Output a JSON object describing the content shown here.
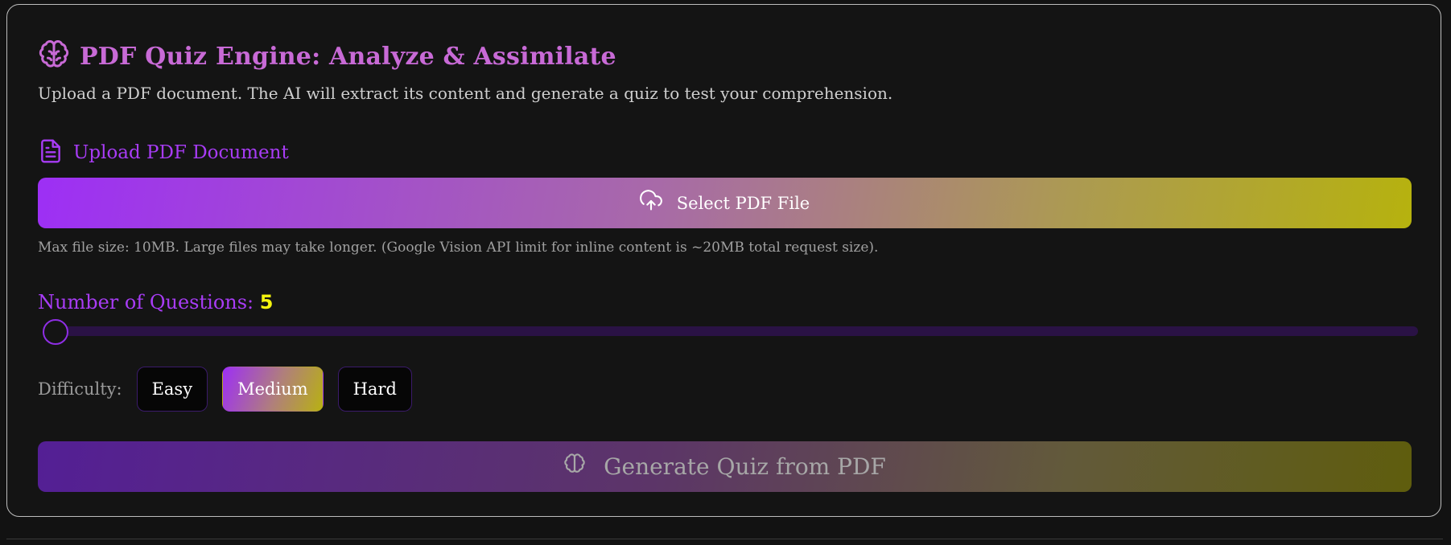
{
  "header": {
    "title": "PDF Quiz Engine: Analyze & Assimilate",
    "subtitle": "Upload a PDF document. The AI will extract its content and generate a quiz to test your comprehension.",
    "icon": "brain-icon"
  },
  "upload": {
    "label": "Upload PDF Document",
    "icon": "document-icon",
    "button_label": "Select PDF File",
    "button_icon": "cloud-upload-icon",
    "hint": "Max file size: 10MB. Large files may take longer. (Google Vision API limit for inline content is ~20MB total request size)."
  },
  "questions": {
    "label": "Number of Questions:",
    "value": "5"
  },
  "difficulty": {
    "label": "Difficulty:",
    "options": [
      "Easy",
      "Medium",
      "Hard"
    ],
    "selected": "Medium"
  },
  "generate": {
    "label": "Generate Quiz from PDF",
    "icon": "brain-icon",
    "disabled": true
  },
  "colors": {
    "accent_purple": "#a83cf6",
    "title_pink": "#c86ad6",
    "value_yellow": "#f4f40e",
    "gradient_start": "#9d2ff5",
    "gradient_end": "#b6b20e"
  }
}
